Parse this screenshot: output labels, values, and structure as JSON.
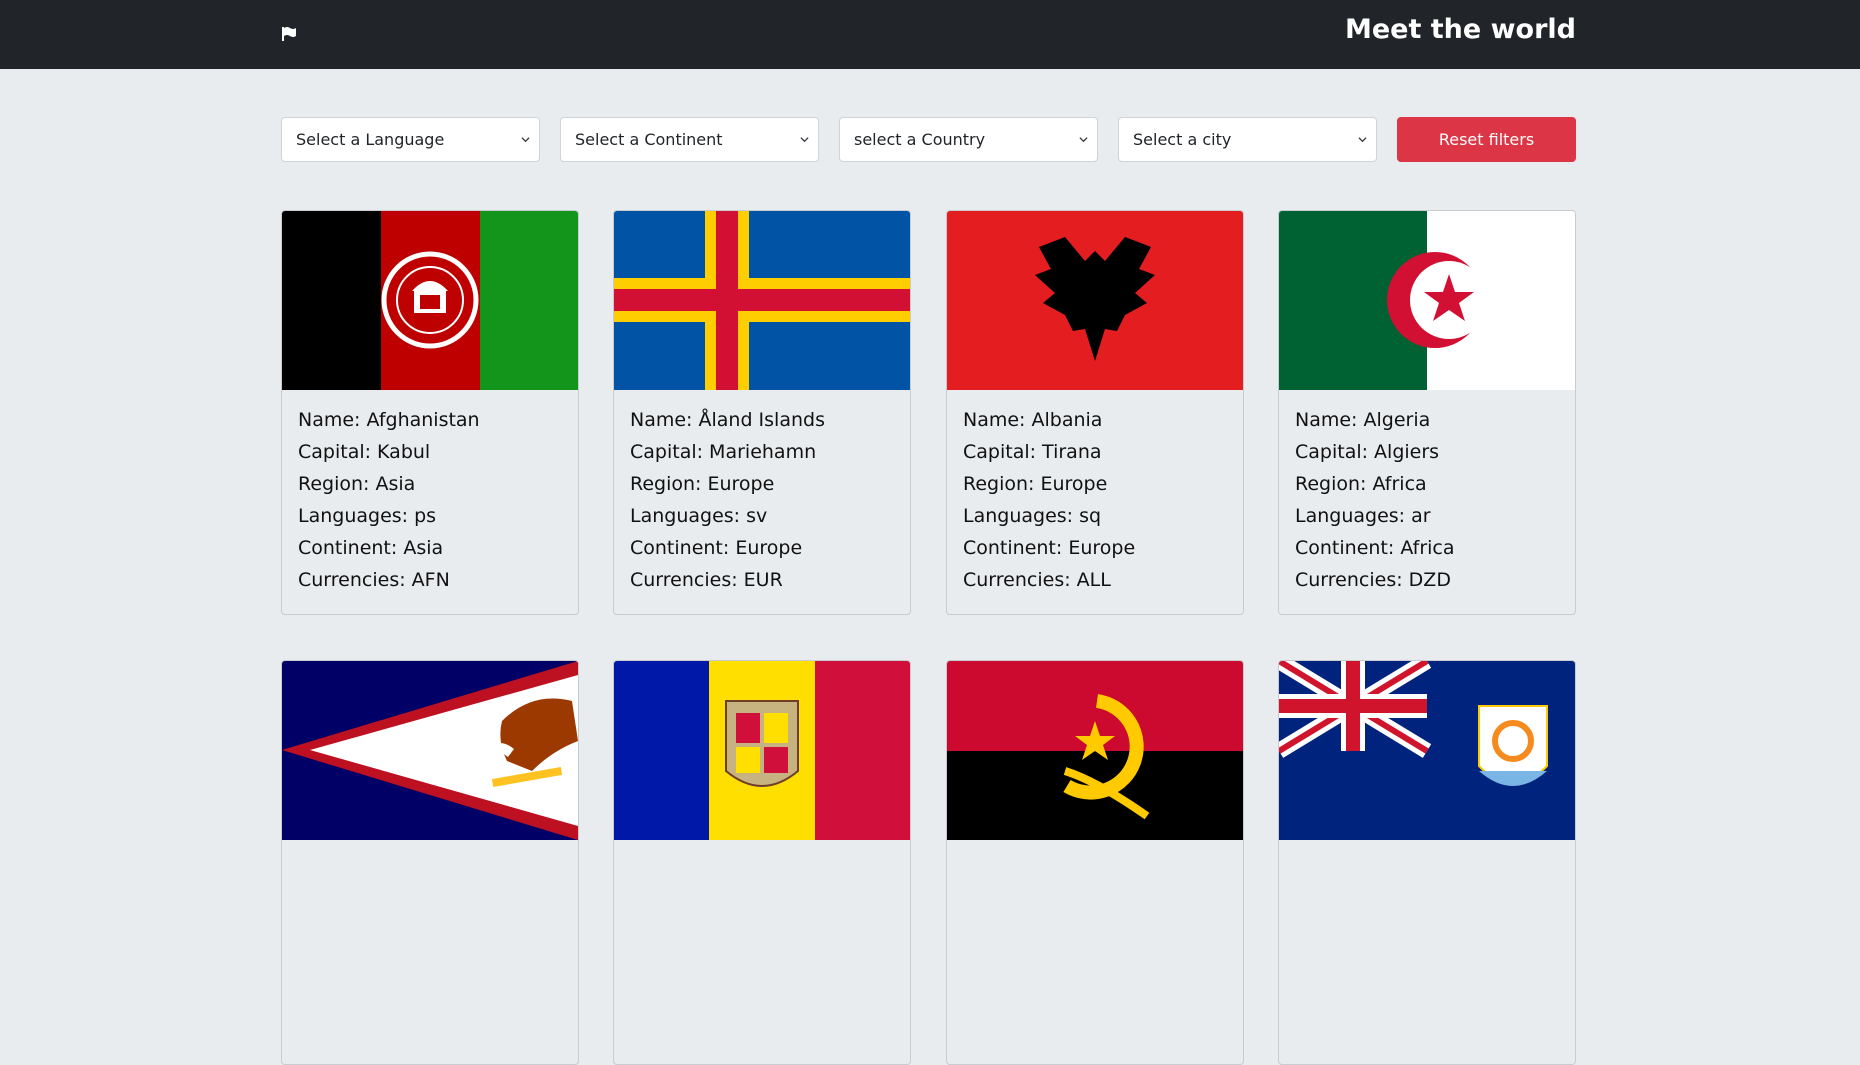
{
  "header": {
    "brand": "Meet the world",
    "flag_icon": "flag-icon"
  },
  "filters": {
    "language": "Select a Language",
    "continent": "Select a Continent",
    "country": "select a Country",
    "city": "Select a city",
    "reset": "Reset filters"
  },
  "countries": [
    {
      "name": "Name: Afghanistan",
      "capital": "Capital: Kabul",
      "region": "Region: Asia",
      "languages": "Languages: ps",
      "continent": "Continent: Asia",
      "currencies": "Currencies: AFN",
      "flag": "afghanistan-flag"
    },
    {
      "name": "Name: Åland Islands",
      "capital": "Capital: Mariehamn",
      "region": "Region: Europe",
      "languages": "Languages: sv",
      "continent": "Continent: Europe",
      "currencies": "Currencies: EUR",
      "flag": "aland-flag"
    },
    {
      "name": "Name: Albania",
      "capital": "Capital: Tirana",
      "region": "Region: Europe",
      "languages": "Languages: sq",
      "continent": "Continent: Europe",
      "currencies": "Currencies: ALL",
      "flag": "albania-flag"
    },
    {
      "name": "Name: Algeria",
      "capital": "Capital: Algiers",
      "region": "Region: Africa",
      "languages": "Languages: ar",
      "continent": "Continent: Africa",
      "currencies": "Currencies: DZD",
      "flag": "algeria-flag"
    },
    {
      "flag": "american-samoa-flag"
    },
    {
      "flag": "andorra-flag"
    },
    {
      "flag": "angola-flag"
    },
    {
      "flag": "anguilla-flag"
    }
  ],
  "colors": {
    "navbar": "#212529",
    "reset_button": "#dc3545",
    "page_bg": "#e9ecef"
  }
}
